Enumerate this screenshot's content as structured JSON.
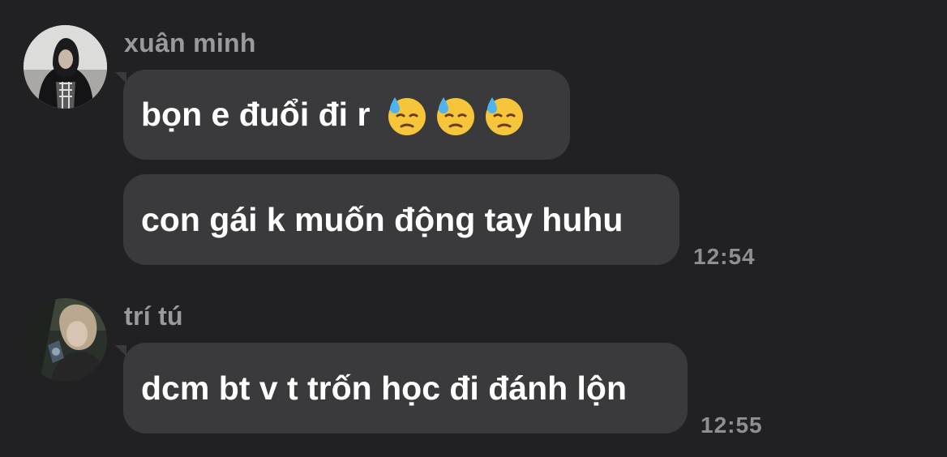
{
  "messages": [
    {
      "sender": "xuân minh",
      "lines": [
        {
          "text": "bọn e đuổi đi r",
          "emojis": [
            "downcast-face-with-sweat",
            "downcast-face-with-sweat",
            "downcast-face-with-sweat"
          ]
        },
        {
          "text": "con gái k muốn động tay huhu"
        }
      ],
      "time": "12:54"
    },
    {
      "sender": "trí tú",
      "lines": [
        {
          "text": "dcm bt v t trốn học đi đánh lộn"
        }
      ],
      "time": "12:55"
    }
  ],
  "colors": {
    "background": "#212123",
    "bubble": "#3a3a3c",
    "sender_name": "#9a9a9e",
    "timestamp": "#8e8e93",
    "message_text": "#ffffff"
  }
}
